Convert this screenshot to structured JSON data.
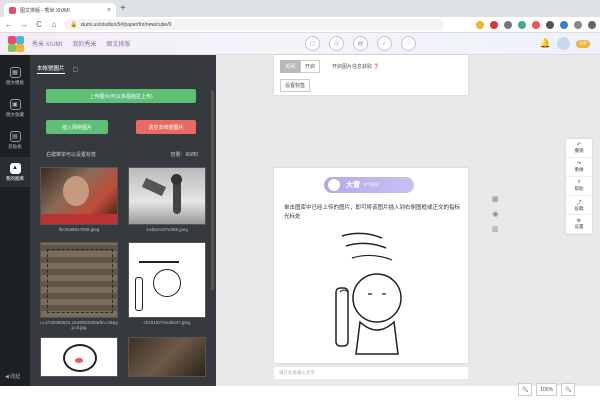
{
  "browser": {
    "tab_title": "图文排版 - 秀米 XIUMI",
    "tab_close": "×",
    "new_tab": "+",
    "url": "xiumi.us/studio/v5#/paper/for/new/cube/0",
    "back": "←",
    "forward": "→",
    "reload": "C",
    "home": "⌂"
  },
  "topnav": {
    "items": [
      "秀米 XIUMI",
      "我的秀米",
      "图文排版"
    ],
    "vip": "VIP"
  },
  "rail": {
    "items": [
      {
        "label": "图文模板",
        "icon": "▦"
      },
      {
        "label": "图文收藏",
        "icon": "▣"
      },
      {
        "label": "剪贴板",
        "icon": "▤"
      },
      {
        "label": "我的图库",
        "icon": "▲"
      }
    ],
    "collapse": "◀ 收起"
  },
  "panel": {
    "tab_active": "本帐號圖片",
    "tab_other": "▢",
    "upload_label": "上传图片(可以多图拖拉上传)",
    "insert_label": "插入网络图片",
    "clear_label": "清空本帐號图片",
    "hint": "右键菜单可以设置标签",
    "capacity": "容量：60/80",
    "thumbs": [
      {
        "caption": "lfechat8817806.jpeg"
      },
      {
        "caption": "1v4bce167e35b.jpeg"
      },
      {
        "caption": "u=2720390524,1649023259&fm=26&gp=0.jpg"
      },
      {
        "caption": "ch1915274ed9447.jpeg"
      },
      {
        "caption": ""
      },
      {
        "caption": ""
      }
    ]
  },
  "canvas": {
    "seg_off": "关闭",
    "seg_on": "开启",
    "seg_note": "开启图片信息获取 ❓",
    "set_button": "设置标签",
    "pill_big": "大雪",
    "pill_small": "节气知识",
    "main_text": "单击图库中已经上传的图片，即可将该图片插入到右侧图框或正文的指标光标处",
    "input_placeholder": "请在此处输入文字",
    "side_tools": [
      {
        "icon": "↶",
        "label": "撤销"
      },
      {
        "icon": "↷",
        "label": "重做"
      },
      {
        "icon": "?",
        "label": "帮助"
      },
      {
        "icon": "⤴",
        "label": "投稿"
      },
      {
        "icon": "⚙",
        "label": "设置"
      }
    ],
    "mini_tools": [
      "▦",
      "◉",
      "▥"
    ],
    "zoom_minus": "🔍",
    "zoom_level": "100%",
    "zoom_plus": "🔍"
  },
  "colors": {
    "green": "#5fbf77",
    "red": "#e86b63",
    "rail": "#1e2124",
    "panel": "#363a3f"
  }
}
